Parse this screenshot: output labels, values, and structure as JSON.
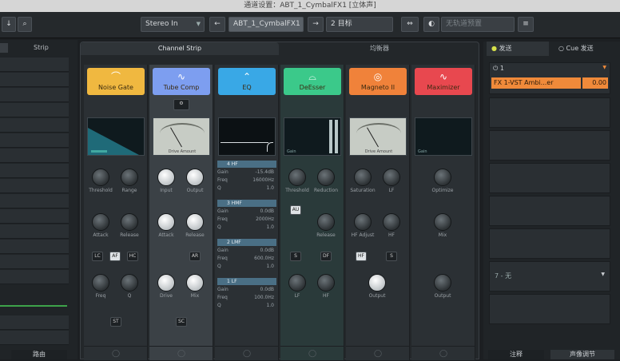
{
  "window": {
    "title": "通道设置：ABT_1_CymbalFX1 [立体声]"
  },
  "toolbar": {
    "routing": "Stereo In",
    "track_name": "ABT_1_CymbalFX1",
    "target_count": "2 目标",
    "search_placeholder": "无轨道预置"
  },
  "left_panel": {
    "tab": "Strip",
    "bottom_label": "路由"
  },
  "center_panel": {
    "tab_channel_strip": "Channel Strip",
    "tab_other": "均衡器"
  },
  "modules": [
    {
      "name": "Noise Gate",
      "color": "#f0b840",
      "icon": "gate-curve-icon",
      "knobs": [
        "Threshold",
        "Range",
        "Attack",
        "Release",
        "Freq",
        "Q"
      ],
      "buttons": [
        "LC",
        "AF",
        "HC",
        "ST"
      ]
    },
    {
      "name": "Tube Comp",
      "color": "#7d9ef0",
      "icon": "comp-curve-icon",
      "meter_label": "Drive Amount",
      "knobs": [
        "Input",
        "Output",
        "Attack",
        "Release",
        "Drive",
        "Mix"
      ],
      "buttons": [
        "AR",
        "SC"
      ]
    },
    {
      "name": "EQ",
      "color": "#39a8e6",
      "icon": "eq-curve-icon",
      "bands": [
        {
          "label": "4 HF",
          "gain": "-15.4dB",
          "freq": "16000Hz",
          "q": "1.0"
        },
        {
          "label": "3 HMF",
          "gain": "0.0dB",
          "freq": "2000Hz",
          "q": "1.0"
        },
        {
          "label": "2 LMF",
          "gain": "0.0dB",
          "freq": "600.0Hz",
          "q": "1.0"
        },
        {
          "label": "1 LF",
          "gain": "0.0dB",
          "freq": "100.0Hz",
          "q": "1.0"
        }
      ]
    },
    {
      "name": "DeEsser",
      "color": "#3bc98a",
      "icon": "deesser-curve-icon",
      "meter_label": "Gain",
      "knobs": [
        "Threshold",
        "Reduction",
        "Release",
        "LF",
        "HF"
      ],
      "buttons": [
        "AU",
        "S",
        "DF"
      ]
    },
    {
      "name": "Magneto II",
      "color": "#f0823a",
      "icon": "tape-reel-icon",
      "meter_label": "Drive Amount",
      "knobs": [
        "Saturation",
        "LF",
        "HF Adjust",
        "HF",
        "Output"
      ],
      "buttons": [
        "HF",
        "S"
      ]
    },
    {
      "name": "Maximizer",
      "color": "#e8484f",
      "icon": "wave-icon",
      "meter_label": "Gain",
      "knobs": [
        "Optimize",
        "Mix",
        "Output"
      ]
    }
  ],
  "right_panel": {
    "tab_sends": "发送",
    "tab_cue": "Cue 发送",
    "slot_number": "1",
    "send_name": "FX 1-VST Ambi...er",
    "send_value": "0.00",
    "dropdown": "7 - 无",
    "bottom_left": "注释",
    "bottom_right": "声像调节"
  }
}
